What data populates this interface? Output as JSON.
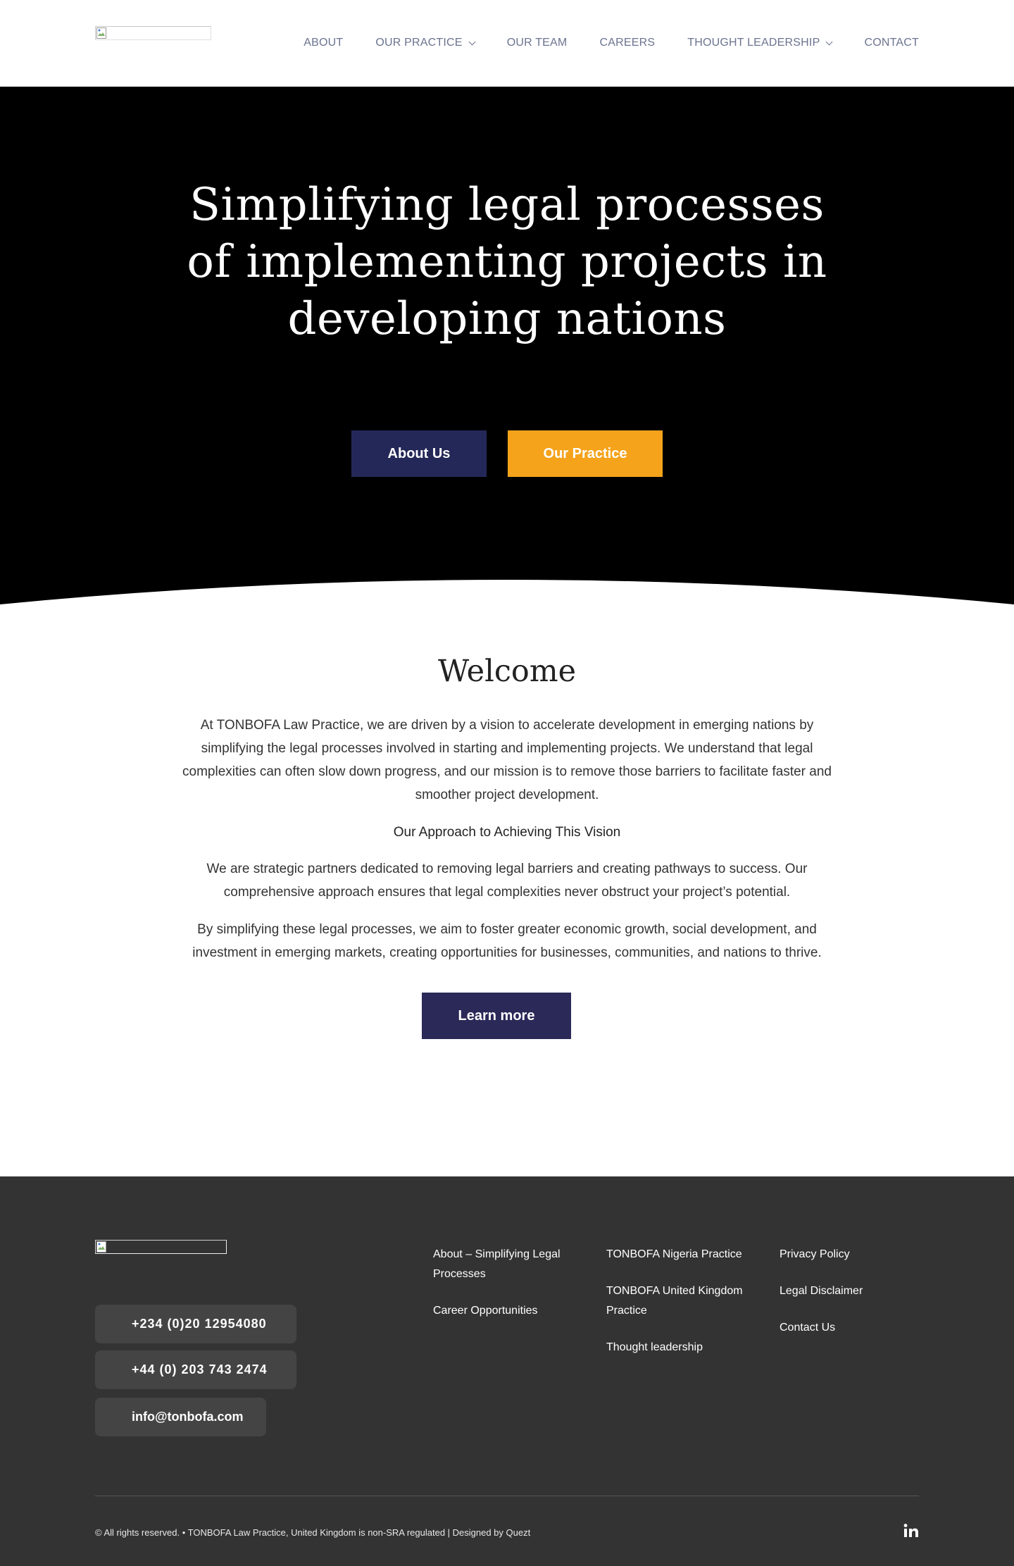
{
  "header": {
    "nav": [
      {
        "label": "ABOUT",
        "dropdown": false
      },
      {
        "label": "OUR PRACTICE",
        "dropdown": true
      },
      {
        "label": "OUR TEAM",
        "dropdown": false
      },
      {
        "label": "CAREERS",
        "dropdown": false
      },
      {
        "label": "THOUGHT LEADERSHIP",
        "dropdown": true
      },
      {
        "label": "CONTACT",
        "dropdown": false
      }
    ]
  },
  "hero": {
    "title_lines": [
      "Simplifying legal processes",
      "of implementing projects in",
      "developing nations"
    ],
    "about_button": "About Us",
    "practice_button": "Our Practice"
  },
  "welcome": {
    "title": "Welcome",
    "paragraph1": "At TONBOFA Law Practice, we are driven by a vision to accelerate development in emerging nations by simplifying the legal processes involved in starting and implementing projects. We understand that legal complexities can often slow down progress, and our mission is to remove those barriers to facilitate faster and smoother project development.",
    "subheading": "Our Approach to Achieving This Vision",
    "paragraph2": "We are strategic partners dedicated to removing legal barriers and creating pathways to success. Our comprehensive approach ensures that legal complexities never obstruct your project’s potential.",
    "paragraph3": "By simplifying these legal processes, we aim to foster greater economic growth, social development, and investment in emerging markets, creating opportunities for businesses, communities, and nations to thrive.",
    "learn_more": "Learn more"
  },
  "footer": {
    "phone_nigeria": "+234 (0)20 12954080",
    "phone_uk": "+44 (0) 203 743 2474",
    "email": "info@tonbofa.com",
    "col1": [
      "About – Simplifying Legal Processes",
      "Career Opportunities"
    ],
    "col2": [
      "TONBOFA Nigeria Practice",
      "TONBOFA United Kingdom Practice",
      "Thought leadership"
    ],
    "col3": [
      "Privacy Policy",
      "Legal Disclaimer",
      "Contact Us"
    ],
    "copyright": "© All rights reserved. • TONBOFA Law Practice, United Kingdom is non-SRA regulated |  Designed by Quezt",
    "social_icon": "linkedin-icon"
  },
  "colors": {
    "nav_text": "#6b7390",
    "primary_navy": "#242858",
    "accent_orange": "#f5a31b",
    "footer_bg": "#333333"
  }
}
